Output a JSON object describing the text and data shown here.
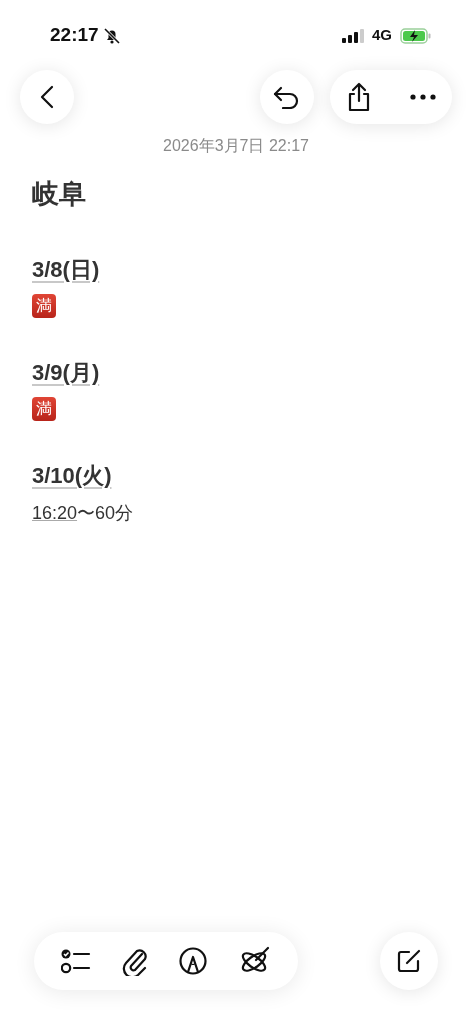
{
  "status_bar": {
    "time": "22:17",
    "network": "4G"
  },
  "note": {
    "timestamp": "2026年3月7日 22:17",
    "title": "岐阜",
    "entries": [
      {
        "heading": "3/8(日)",
        "kind": "badge",
        "text": "満"
      },
      {
        "heading": "3/9(月)",
        "kind": "badge",
        "text": "満"
      },
      {
        "heading": "3/10(火)",
        "kind": "text",
        "link": "16:20",
        "text": "〜60分"
      }
    ]
  }
}
